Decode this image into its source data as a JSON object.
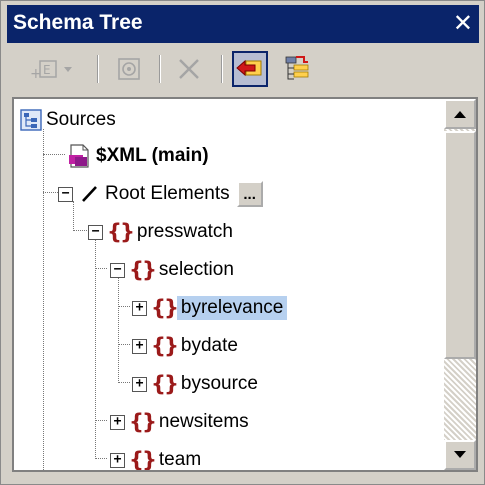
{
  "panel": {
    "title": "Schema Tree",
    "close_label": "✕"
  },
  "tree": {
    "sources_label": "Sources",
    "xml_label": "$XML (main)",
    "root_label": "Root Elements",
    "root_button_label": "...",
    "presswatch_label": "presswatch",
    "selection_label": "selection",
    "byrelevance_label": "byrelevance",
    "bydate_label": "bydate",
    "bysource_label": "bysource",
    "newsitems_label": "newsitems",
    "team_label": "team",
    "selected_item": "byrelevance"
  },
  "colors": {
    "title_bar": "#0a246a",
    "selection": "#b6d0ef",
    "element_icon": "#9b1a1a"
  }
}
